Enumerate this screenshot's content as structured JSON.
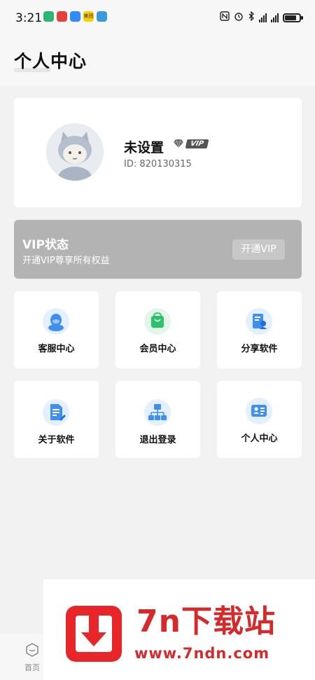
{
  "status_bar": {
    "time": "3:21",
    "apps": [
      {
        "name": "download-app",
        "color": "#2bb673"
      },
      {
        "name": "red-app",
        "color": "#e8403a"
      },
      {
        "name": "cloud-app",
        "color": "#2f8bff"
      },
      {
        "name": "meituan-app",
        "color": "#ffd000",
        "label": "美团"
      },
      {
        "name": "camera-app",
        "color": "#3a9bdc"
      }
    ]
  },
  "header": {
    "title": "个人中心"
  },
  "profile": {
    "username": "未设置",
    "vip_badge": "VIP",
    "user_id": "ID: 820130315"
  },
  "vip_banner": {
    "title": "VIP状态",
    "subtitle": "开通VIP尊享所有权益",
    "button_label": "开通VIP"
  },
  "grid": [
    {
      "label": "客服中心",
      "icon": "customer-service-icon",
      "color": "#e3f0ff",
      "fg": "#3f8ef0"
    },
    {
      "label": "会员中心",
      "icon": "member-bag-icon",
      "color": "#e2f7ea",
      "fg": "#2dc16a"
    },
    {
      "label": "分享软件",
      "icon": "share-doc-icon",
      "color": "#e3f0ff",
      "fg": "#3f8ef0"
    },
    {
      "label": "关于软件",
      "icon": "about-doc-icon",
      "color": "#e3f0ff",
      "fg": "#3f8ef0"
    },
    {
      "label": "退出登录",
      "icon": "logout-network-icon",
      "color": "#e3f0ff",
      "fg": "#3f8ef0"
    },
    {
      "label": "个人中心",
      "icon": "id-card-icon",
      "color": "#e3f0ff",
      "fg": "#3f8ef0"
    }
  ],
  "bottom_nav": {
    "home_label": "首页"
  },
  "watermark": {
    "title": "7n下载站",
    "url": "www.7ndn.com",
    "color": "#d42a2c"
  }
}
